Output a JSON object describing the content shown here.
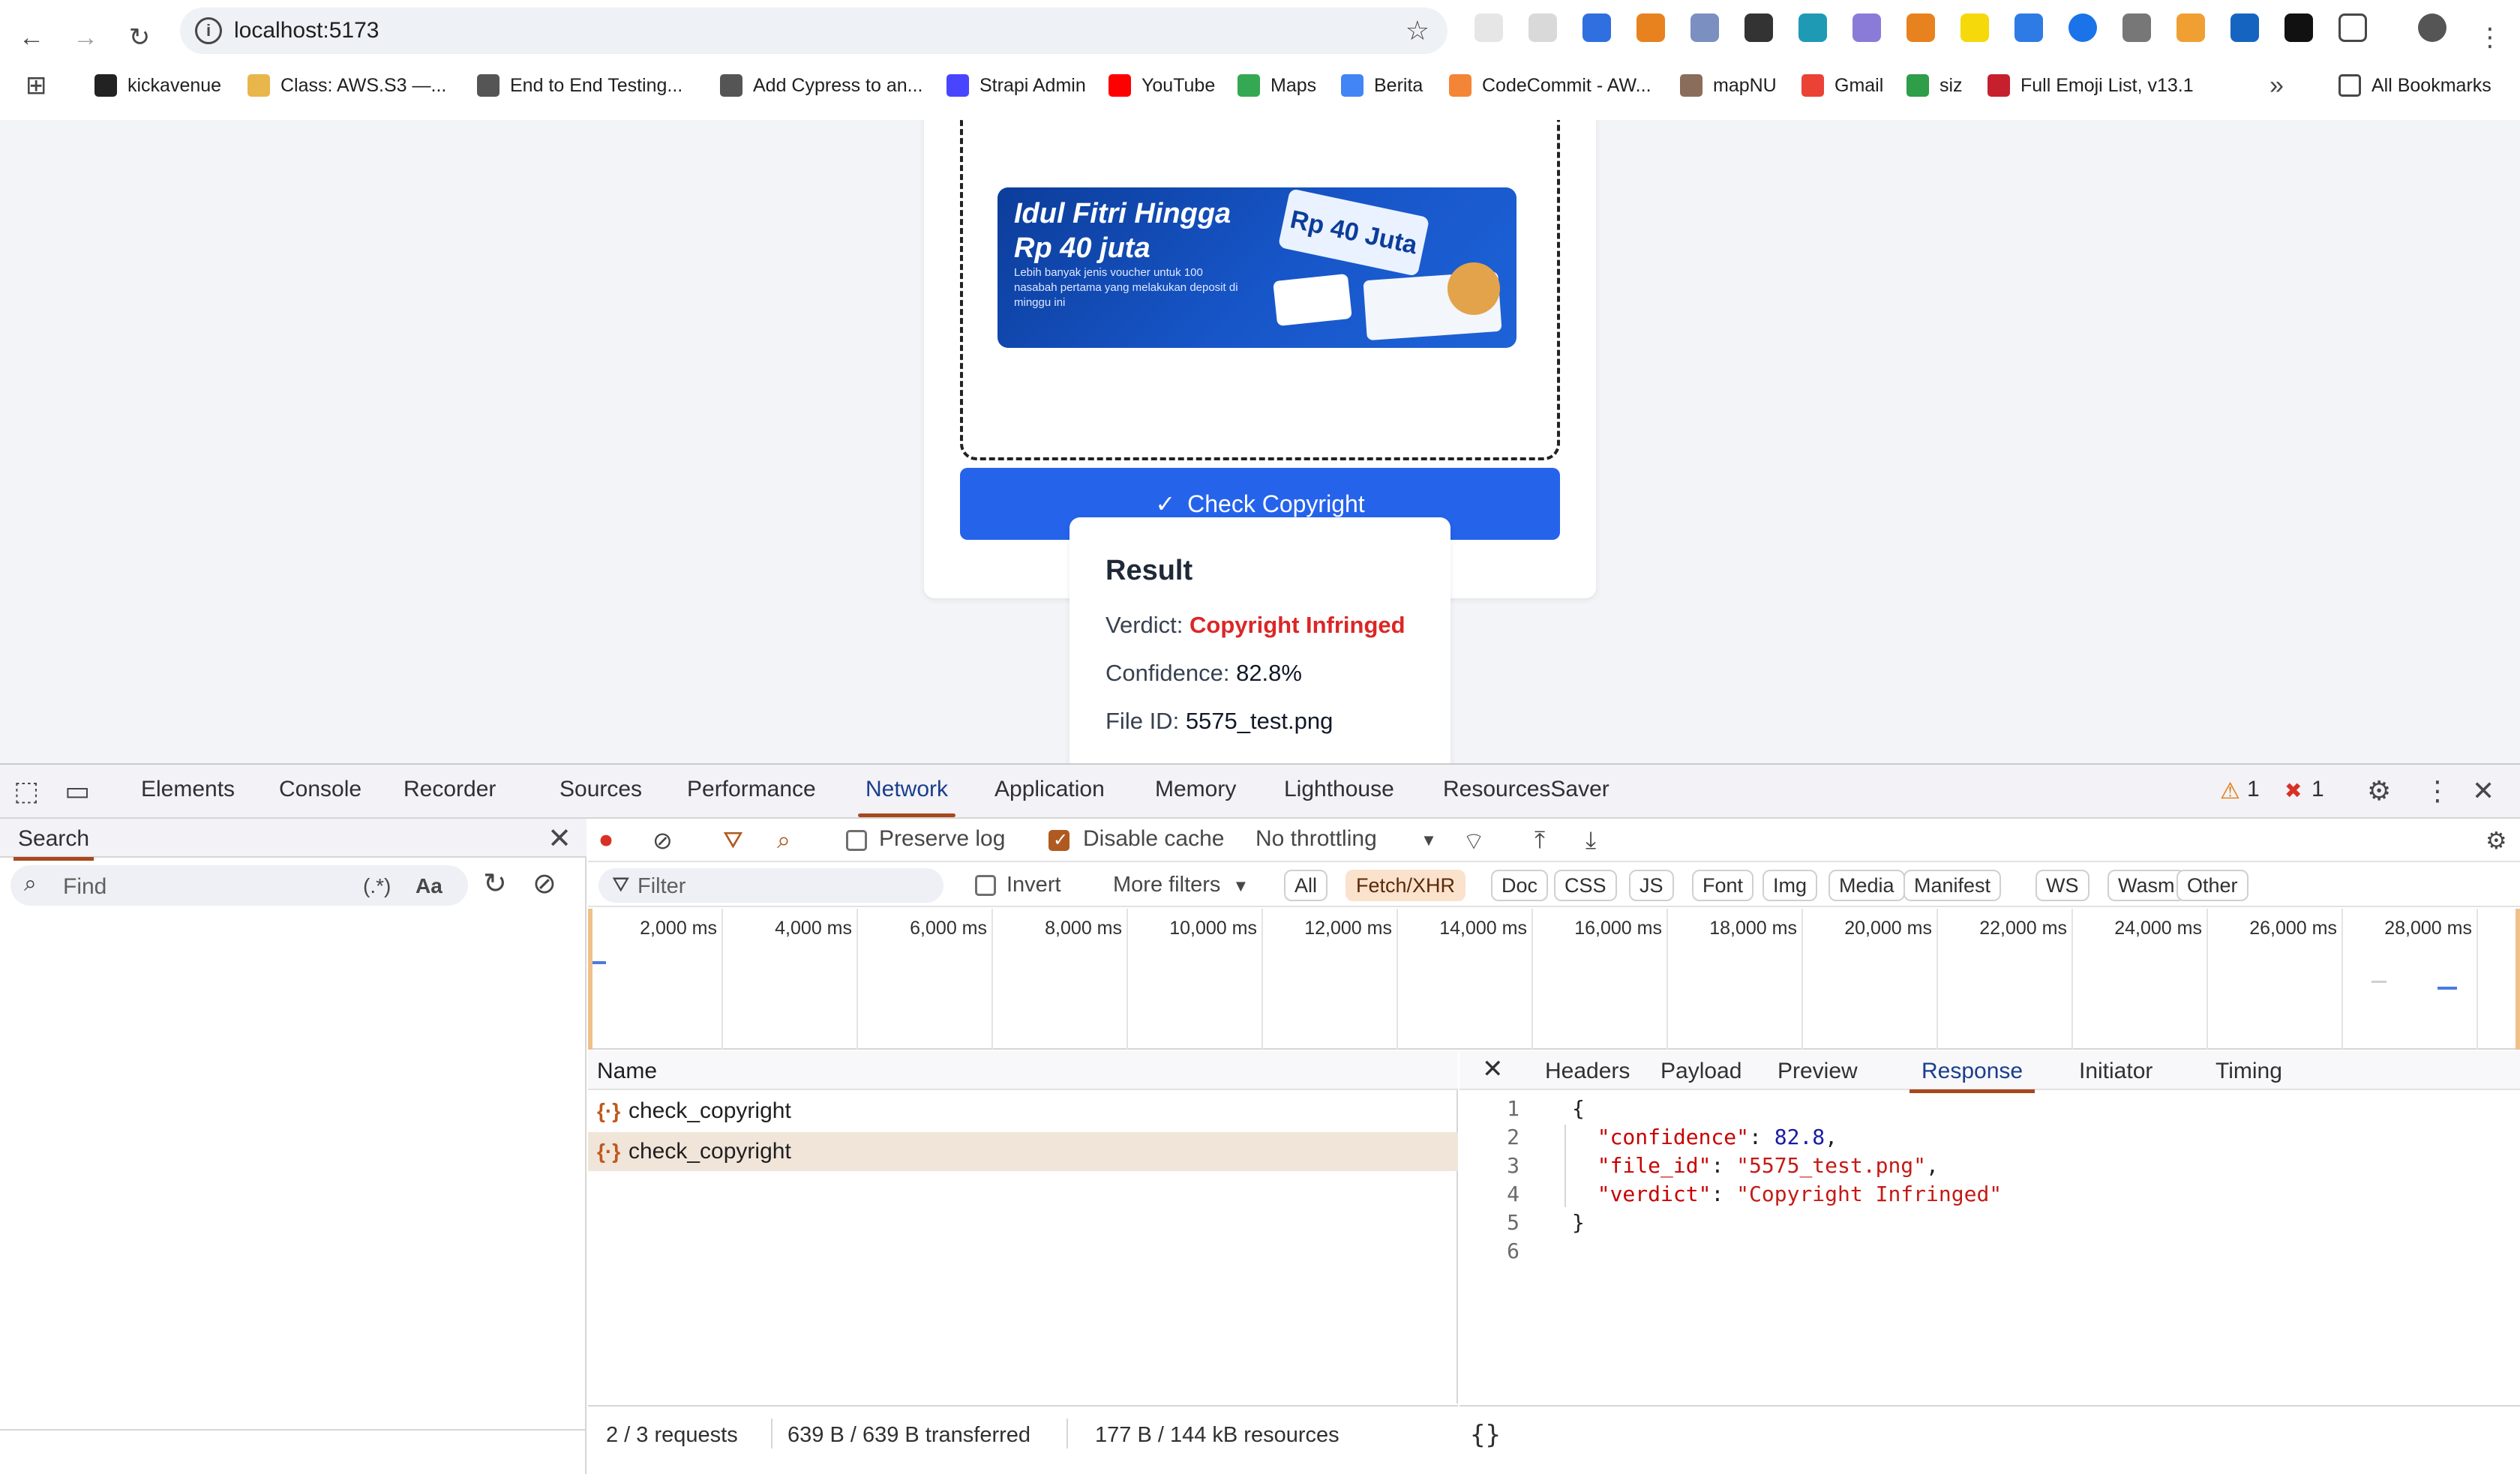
{
  "browser": {
    "url": "localhost:5173",
    "bookmarks": [
      {
        "label": "kickavenue",
        "color": "#222222"
      },
      {
        "label": "Class: AWS.S3 —...",
        "color": "#e8b64a"
      },
      {
        "label": "End to End Testing...",
        "color": "#555555"
      },
      {
        "label": "Add Cypress to an...",
        "color": "#555555"
      },
      {
        "label": "Strapi Admin",
        "color": "#4945ff"
      },
      {
        "label": "YouTube",
        "color": "#ff0000"
      },
      {
        "label": "Maps",
        "color": "#34a853"
      },
      {
        "label": "Berita",
        "color": "#4285f4"
      },
      {
        "label": "CodeCommit - AW...",
        "color": "#f58536"
      },
      {
        "label": "mapNU",
        "color": "#8a6d5a"
      },
      {
        "label": "Gmail",
        "color": "#ea4335"
      },
      {
        "label": "siz",
        "color": "#2e9e48"
      },
      {
        "label": "Full Emoji List, v13.1",
        "color": "#c6202f"
      }
    ],
    "all_bookmarks": "All Bookmarks"
  },
  "app": {
    "banner": {
      "headline_line1": "Idul Fitri Hingga",
      "headline_line2": "Rp 40 juta",
      "sub": "Lebih banyak jenis voucher untuk 100 nasabah pertama yang melakukan deposit di minggu ini",
      "badge": "Rp 40 Juta"
    },
    "check_button": "Check Copyright",
    "result": {
      "title": "Result",
      "verdict_label": "Verdict:",
      "verdict_value": "Copyright Infringed",
      "confidence_label": "Confidence:",
      "confidence_value": "82.8%",
      "file_label": "File ID:",
      "file_value": "5575_test.png"
    }
  },
  "devtools": {
    "tabs": [
      "Elements",
      "Console",
      "Recorder",
      "Sources",
      "Performance",
      "Network",
      "Application",
      "Memory",
      "Lighthouse",
      "ResourcesSaver"
    ],
    "active_tab": "Network",
    "warnings_count": "1",
    "errors_count": "1",
    "search": {
      "title": "Search",
      "placeholder": "Find",
      "regex": "(.*)",
      "case": "Aa"
    },
    "toolbar": {
      "preserve_log": "Preserve log",
      "preserve_log_checked": false,
      "disable_cache": "Disable cache",
      "disable_cache_checked": true,
      "throttling": "No throttling"
    },
    "filter": {
      "placeholder": "Filter",
      "invert": "Invert",
      "more_filters": "More filters",
      "types": [
        "All",
        "Fetch/XHR",
        "Doc",
        "CSS",
        "JS",
        "Font",
        "Img",
        "Media",
        "Manifest",
        "WS",
        "Wasm",
        "Other"
      ],
      "active_type": "Fetch/XHR"
    },
    "timeline_ticks": [
      "2,000 ms",
      "4,000 ms",
      "6,000 ms",
      "8,000 ms",
      "10,000 ms",
      "12,000 ms",
      "14,000 ms",
      "16,000 ms",
      "18,000 ms",
      "20,000 ms",
      "22,000 ms",
      "24,000 ms",
      "26,000 ms",
      "28,000 ms"
    ],
    "requests_header": "Name",
    "requests": [
      {
        "name": "check_copyright",
        "selected": false
      },
      {
        "name": "check_copyright",
        "selected": true
      }
    ],
    "detail_tabs": [
      "Headers",
      "Payload",
      "Preview",
      "Response",
      "Initiator",
      "Timing"
    ],
    "active_detail_tab": "Response",
    "response": {
      "confidence_key": "\"confidence\"",
      "confidence_val": "82.8",
      "file_id_key": "\"file_id\"",
      "file_id_val": "\"5575_test.png\"",
      "verdict_key": "\"verdict\"",
      "verdict_val": "\"Copyright Infringed\""
    },
    "status": {
      "requests": "2 / 3 requests",
      "transferred": "639 B / 639 B transferred",
      "resources": "177 B / 144 kB resources"
    },
    "pretty_print": "{}"
  }
}
